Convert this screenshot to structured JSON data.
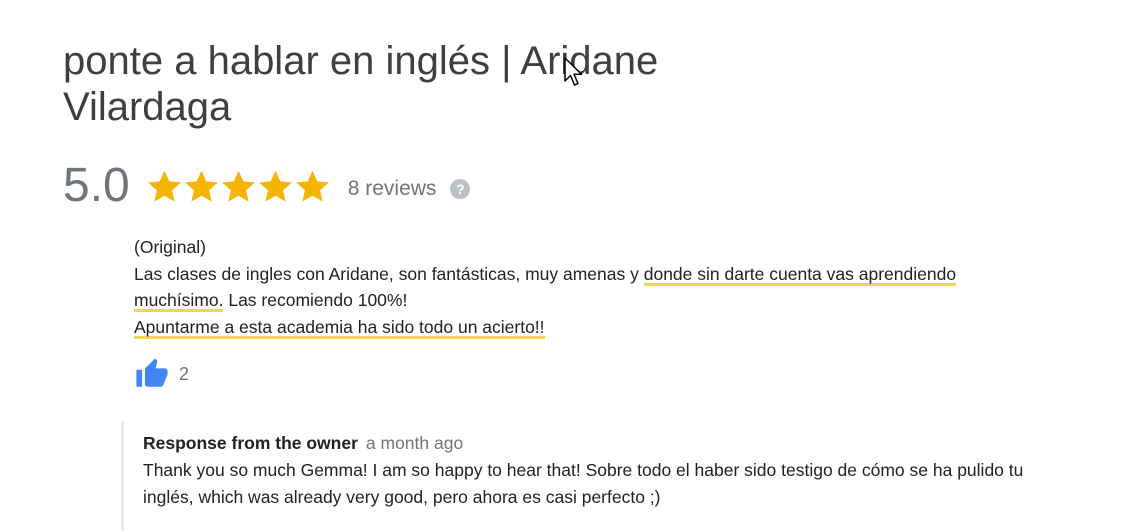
{
  "business": {
    "title_line1": "ponte a hablar en inglés | Aridane",
    "title_line2": "Vilardaga"
  },
  "rating": {
    "value": "5.0",
    "stars": 5,
    "star_color": "#f4b400",
    "reviews_label": "8 reviews",
    "help_icon_label": "?"
  },
  "review": {
    "original_label": "(Original)",
    "text_part1": "Las clases de ingles con Aridane, son fantásticas, muy amenas y ",
    "text_highlight1": "donde sin darte cuenta vas aprendiendo muchísimo.",
    "text_part2": " Las recomiendo 100%!",
    "text_highlight2": "Apuntarme a esta academia ha sido todo un acierto!!",
    "highlight_color": "#f4d25c",
    "likes_count": "2",
    "like_icon": "thumbs-up-icon",
    "like_color": "#4285f4"
  },
  "response": {
    "author_label": "Response from the owner",
    "time": "a month ago",
    "text": "Thank you so much Gemma! I am so happy to hear that! Sobre todo el haber sido testigo de cómo se ha pulido tu inglés, which was already very good, pero ahora es casi perfecto ;)"
  }
}
